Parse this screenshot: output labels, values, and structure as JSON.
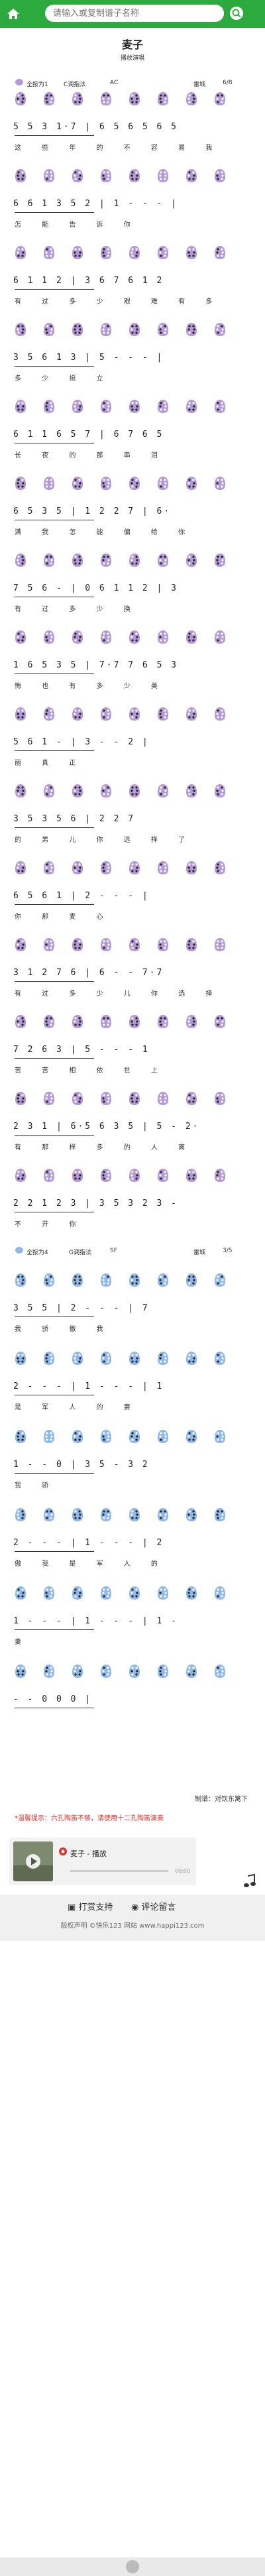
{
  "header": {
    "search_placeholder": "请输入或复制谱子名称"
  },
  "song": {
    "title": "麦子",
    "performer": "播放演唱"
  },
  "meta1": {
    "key_label": "全按为1",
    "tuning": "C调指法",
    "tone": "AC",
    "singer": "雷城",
    "time": "6/8"
  },
  "meta2": {
    "key_label": "全按为4",
    "tuning": "G调指法",
    "tone": "SF",
    "singer": "雷城",
    "time": "3/5"
  },
  "score": {
    "lines": [
      {
        "nums": "5 5 3 1·7 | 6 5 6 5 6 5",
        "lyrics": "这 些 年 的 不 容 易 我"
      },
      {
        "nums": "6 6 1 3 5 2 | 1 - - - |",
        "lyrics": "怎 能 告 诉 你"
      },
      {
        "nums": "6 1 1 2 | 3 6 7 6 1 2",
        "lyrics": "有 过 多 少 艰 难 有 多"
      },
      {
        "nums": "3 5 6 1 3 | 5 - - - |",
        "lyrics": "多 少 挺 立"
      },
      {
        "nums": "6 1 1 6 5 7 | 6 7 6 5",
        "lyrics": "长 夜 的 那 串 泪"
      },
      {
        "nums": "6 5 3 5 | 1 2 2 7 | 6·",
        "lyrics": "满 我 怎 能 偏 给 你"
      },
      {
        "nums": "7 5 6 - | 0 6 1 1 2 | 3",
        "lyrics": "有 过 多 少 换"
      },
      {
        "nums": "1 6 5 3 5 | 7·7 7 6 5 3",
        "lyrics": "悔 也 有 多 少 美"
      },
      {
        "nums": "5 6 1 - | 3 - - 2 |",
        "lyrics": "丽 真 正"
      },
      {
        "nums": "3 5 3 5 6 | 2 2 7",
        "lyrics": "的 男 儿 你 选 择 了"
      },
      {
        "nums": "6 5 6 1 | 2 - - - |",
        "lyrics": "你 那 麦 心"
      },
      {
        "nums": "3 1 2 7 6 | 6 - - 7·7",
        "lyrics": "有 过 多 少 儿 你 选 择"
      },
      {
        "nums": "7 2 6 3 | 5 - - - 1",
        "lyrics": "苦 苦 相 依 世 上"
      },
      {
        "nums": "2 3 1 | 6·5 6 3 5 | 5 - 2·",
        "lyrics": "有 那 样 多 的 人 离"
      },
      {
        "nums": "2 2 1 2 3 | 3 5 3 2 3 -",
        "lyrics": "不 开 你"
      },
      {
        "nums": "3 5 5 | 2 - - - | 7",
        "lyrics": "我 骄 傲 我"
      },
      {
        "nums": "2 - - - | 1 - - - | 1",
        "lyrics": "是 军 人 的 妻"
      },
      {
        "nums": "1 - - 0 | 3 5 - 3 2",
        "lyrics": "我 骄"
      },
      {
        "nums": "2 - - - | 1 - - - | 2",
        "lyrics": "傲 我 是 军 人 的"
      },
      {
        "nums": "1 - - - | 1 - - - | 1 -",
        "lyrics": "妻"
      },
      {
        "nums": "- - 0 0 0 |",
        "lyrics": ""
      }
    ]
  },
  "footer_section": {
    "author": "制谱：对饮东篱下",
    "tip": "*温馨提示：六孔陶笛不够，请使用十二孔陶笛演奏",
    "player_title": "麦子 - 播放",
    "player_time": "00:00",
    "support": "打赏支持",
    "comment": "评论留言",
    "copyright": "版权声明  ©快乐123 网站 www.happi123.com"
  }
}
